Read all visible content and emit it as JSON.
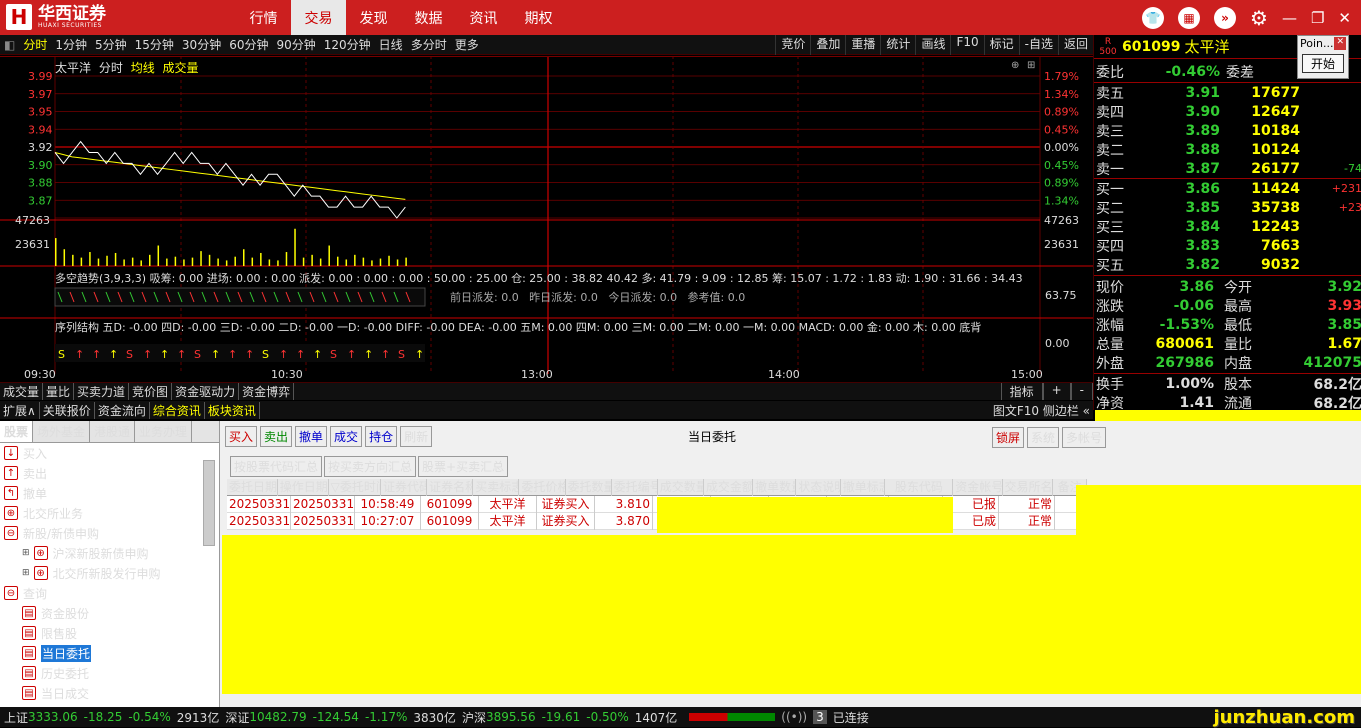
{
  "app": {
    "brand_cn": "华西证券",
    "brand_en": "HUAXI SECURITIES"
  },
  "nav": [
    "行情",
    "交易",
    "发现",
    "数据",
    "资讯",
    "期权"
  ],
  "nav_active": 1,
  "periods": [
    "分时",
    "1分钟",
    "5分钟",
    "15分钟",
    "30分钟",
    "60分钟",
    "90分钟",
    "120分钟",
    "日线",
    "多分时",
    "更多"
  ],
  "chart_tools": [
    "竞价",
    "叠加",
    "重播",
    "统计",
    "画线",
    "F10",
    "标记",
    "-自选",
    "返回"
  ],
  "chart_label": {
    "name": "太平洋",
    "mode": "分时",
    "avg": "均线",
    "vol": "成交量"
  },
  "chart_data": {
    "type": "line",
    "title": "太平洋 分时",
    "x_ticks": [
      "09:30",
      "10:30",
      "13:00",
      "14:00",
      "15:00"
    ],
    "y_price_ticks": [
      "3.99",
      "3.97",
      "3.95",
      "3.94",
      "3.92",
      "3.90",
      "3.88",
      "3.87"
    ],
    "y_pct_ticks": [
      "1.79%",
      "1.34%",
      "0.89%",
      "0.45%",
      "0.00%",
      "0.45%",
      "0.89%",
      "1.34%"
    ],
    "vol_ticks": [
      "47263",
      "23631"
    ],
    "prev_close": 3.92,
    "price": [
      3.92,
      3.91,
      3.92,
      3.93,
      3.92,
      3.92,
      3.91,
      3.92,
      3.91,
      3.91,
      3.9,
      3.91,
      3.9,
      3.91,
      3.92,
      3.91,
      3.92,
      3.91,
      3.91,
      3.9,
      3.91,
      3.9,
      3.89,
      3.9,
      3.89,
      3.9,
      3.9,
      3.89,
      3.88,
      3.89,
      3.88,
      3.88,
      3.87,
      3.87,
      3.88,
      3.87,
      3.87,
      3.88,
      3.87,
      3.87,
      3.86,
      3.87
    ],
    "avg": [
      3.92,
      3.918,
      3.916,
      3.915,
      3.914,
      3.913,
      3.912,
      3.911,
      3.91,
      3.909,
      3.908,
      3.907,
      3.906,
      3.905,
      3.904,
      3.903,
      3.902,
      3.901,
      3.9,
      3.899,
      3.898,
      3.897,
      3.896,
      3.895,
      3.894,
      3.893,
      3.892,
      3.891,
      3.89,
      3.889,
      3.888,
      3.887,
      3.886,
      3.885,
      3.884,
      3.883,
      3.882,
      3.881,
      3.88,
      3.879,
      3.878,
      3.877
    ],
    "volume": [
      30000,
      18000,
      12000,
      9000,
      15000,
      8000,
      11000,
      14000,
      7000,
      9000,
      6000,
      12000,
      22000,
      8000,
      10000,
      7000,
      9000,
      16000,
      12000,
      8000,
      6000,
      10000,
      18000,
      9000,
      14000,
      7000,
      6000,
      15000,
      40000,
      9000,
      12000,
      8000,
      22000,
      10000,
      7000,
      12000,
      9000,
      6000,
      8000,
      11000,
      7000,
      9000
    ]
  },
  "indicator_line1": "多空趋势(3,9,3,3) 吸筹: 0.00 进场: 0.00 : 0.00 派发: 0.00 : 0.00 : 0.00 : 50.00 : 25.00 仓: 25.00 : 38.82 40.42 多: 41.79 : 9.09 : 12.85 筹: 15.07 : 1.72 : 1.83 动: 1.90 : 31.66 : 34.43",
  "indicator_line2": "前日派发: 0.0   昨日派发: 0.0   今日派发: 0.0   参考值: 0.0",
  "indicator_line3": "序列结构 五D: -0.00 四D: -0.00 三D: -0.00 二D: -0.00 一D: -0.00 DIFF: -0.00 DEA: -0.00 五M: 0.00 四M: 0.00 三M: 0.00 二M: 0.00 一M: 0.00 MACD: 0.00 金: 0.00 木: 0.00 底背",
  "ind_right": [
    "63.75",
    "0.00"
  ],
  "bottom_tabs": [
    "成交量",
    "量比",
    "买卖力道",
    "竞价图",
    "资金驱动力",
    "资金博弈"
  ],
  "bottom_tabs_right": [
    "指标",
    "+",
    "-"
  ],
  "bottom_tabs2": [
    "扩展∧",
    "关联报价",
    "资金流向",
    "综合资讯",
    "板块资讯"
  ],
  "bottom_tabs2_right": "图文F10 侧边栏 «",
  "quote": {
    "code": "601099",
    "name": "太平洋",
    "wei_bi_label": "委比",
    "wei_bi": "-0.46%",
    "wei_cha_label": "委差",
    "asks": [
      {
        "l": "卖五",
        "p": "3.91",
        "v": "17677",
        "c": ""
      },
      {
        "l": "卖四",
        "p": "3.90",
        "v": "12647",
        "c": ""
      },
      {
        "l": "卖三",
        "p": "3.89",
        "v": "10184",
        "c": ""
      },
      {
        "l": "卖二",
        "p": "3.88",
        "v": "10124",
        "c": ""
      },
      {
        "l": "卖一",
        "p": "3.87",
        "v": "26177",
        "c": "-74"
      }
    ],
    "bids": [
      {
        "l": "买一",
        "p": "3.86",
        "v": "11424",
        "c": "+231"
      },
      {
        "l": "买二",
        "p": "3.85",
        "v": "35738",
        "c": "+23"
      },
      {
        "l": "买三",
        "p": "3.84",
        "v": "12243",
        "c": ""
      },
      {
        "l": "买四",
        "p": "3.83",
        "v": "7663",
        "c": ""
      },
      {
        "l": "买五",
        "p": "3.82",
        "v": "9032",
        "c": ""
      }
    ],
    "stats": [
      {
        "l": "现价",
        "v": "3.86",
        "l2": "今开",
        "v2": "3.92"
      },
      {
        "l": "涨跌",
        "v": "-0.06",
        "l2": "最高",
        "v2": "3.93"
      },
      {
        "l": "涨幅",
        "v": "-1.53%",
        "l2": "最低",
        "v2": "3.85"
      },
      {
        "l": "总量",
        "v": "680061",
        "l2": "量比",
        "v2": "1.67"
      },
      {
        "l": "外盘",
        "v": "267986",
        "l2": "内盘",
        "v2": "412075"
      }
    ],
    "stats2": [
      {
        "l": "换手",
        "v": "1.00%",
        "l2": "股本",
        "v2": "68.2亿"
      },
      {
        "l": "净资",
        "v": "1.41",
        "l2": "流通",
        "v2": "68.2亿"
      }
    ]
  },
  "popup": {
    "title": "Poin...",
    "button": "开始"
  },
  "tree_tabs": [
    "股票",
    "场外基金",
    "港股通",
    "业务办理"
  ],
  "tree": [
    {
      "t": "买入",
      "ic": "↓",
      "lv": 0
    },
    {
      "t": "卖出",
      "ic": "↑",
      "lv": 0
    },
    {
      "t": "撤单",
      "ic": "↰",
      "lv": 0
    },
    {
      "t": "北交所业务",
      "ic": "⊕",
      "lv": 0
    },
    {
      "t": "新股/新债申购",
      "ic": "⊖",
      "lv": 0
    },
    {
      "t": "沪深新股新债申购",
      "ic": "⊕",
      "lv": 1
    },
    {
      "t": "北交所新股发行申购",
      "ic": "⊕",
      "lv": 1
    },
    {
      "t": "查询",
      "ic": "⊖",
      "lv": 0
    },
    {
      "t": "资金股份",
      "ic": "▤",
      "lv": 1
    },
    {
      "t": "限售股",
      "ic": "▤",
      "lv": 1
    },
    {
      "t": "当日委托",
      "ic": "▤",
      "lv": 1,
      "sel": true
    },
    {
      "t": "历史委托",
      "ic": "▤",
      "lv": 1
    },
    {
      "t": "当日成交",
      "ic": "▤",
      "lv": 1
    }
  ],
  "trade_toolbar": [
    "买入",
    "卖出",
    "撤单",
    "成交",
    "持仓",
    "刷新"
  ],
  "trade_title": "当日委托",
  "trade_right": [
    "锁屏",
    "系统",
    "多帐号"
  ],
  "summary_buttons": [
    "按股票代码汇总",
    "按买卖方向汇总",
    "股票+买卖汇总"
  ],
  "grid_headers": [
    "委托日期",
    "操作日期",
    "▽委托时间",
    "证券代码",
    "证券名称",
    "买卖标志",
    "委托价格",
    "委托数量",
    "委托编号",
    "成交数量",
    "成交金额",
    "撤单数量",
    "状态说明",
    "撤单标志",
    "股东代码",
    "资金帐号",
    "交易所名称",
    "备注"
  ],
  "rows": [
    [
      "20250331",
      "20250331",
      "10:58:49",
      "601099",
      "太平洋",
      "证券买入",
      "3.810",
      "",
      "",
      "",
      "",
      "",
      "已报",
      "正常"
    ],
    [
      "20250331",
      "20250331",
      "10:27:07",
      "601099",
      "太平洋",
      "证券买入",
      "3.870",
      "",
      "",
      "",
      "",
      "",
      "已成",
      "正常"
    ]
  ],
  "status": {
    "sh_label": "上证",
    "sh": "3333.06",
    "sh_chg": "-18.25",
    "sh_pct": "-0.54%",
    "sh_amt": "2913亿",
    "sz_label": "深证",
    "sz": "10482.79",
    "sz_chg": "-124.54",
    "sz_pct": "-1.17%",
    "sz_amt": "3830亿",
    "hs_label": "沪深",
    "hs": "3895.56",
    "hs_chg": "-19.61",
    "hs_pct": "-0.50%",
    "hs_amt": "1407亿",
    "conn_count": "3",
    "conn": "已连接",
    "watermark": "junzhuan.com"
  }
}
